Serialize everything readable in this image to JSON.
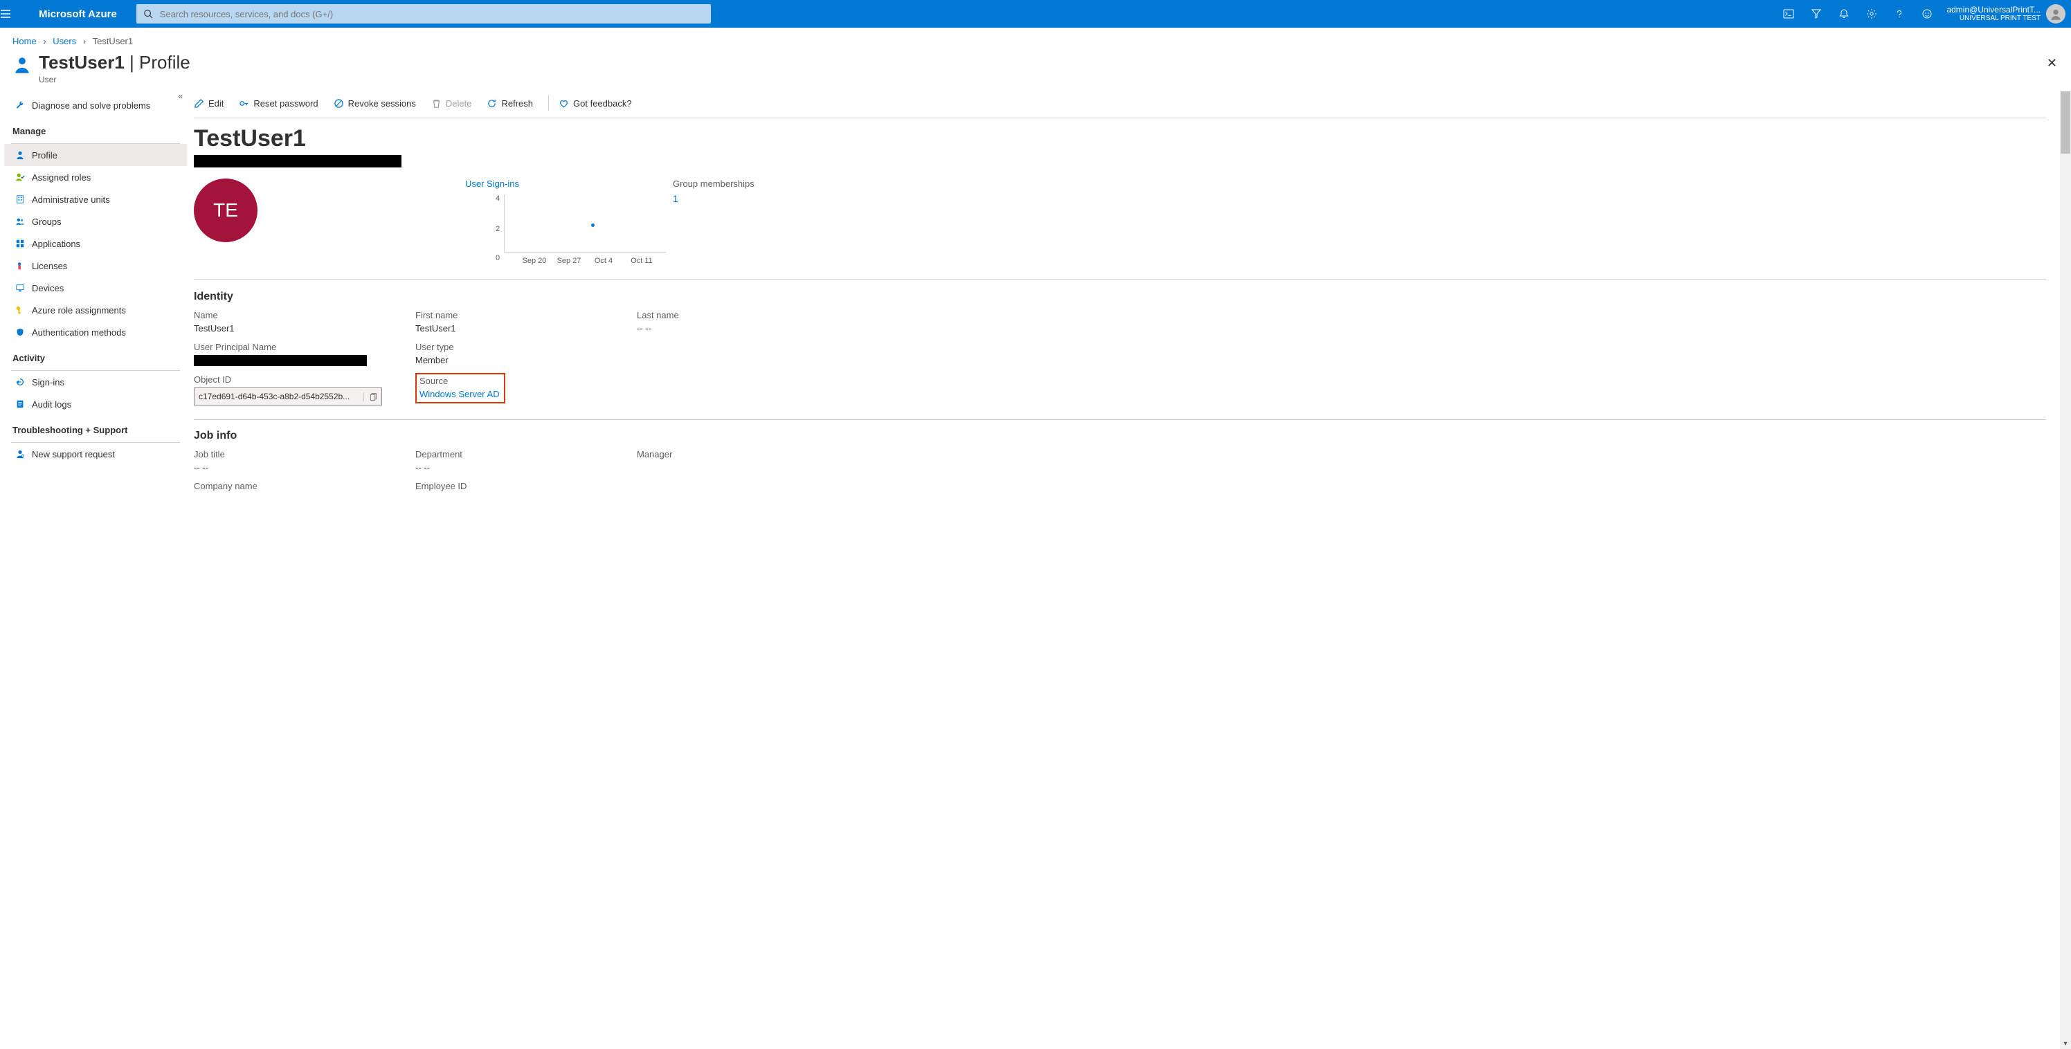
{
  "brand": "Microsoft Azure",
  "search": {
    "placeholder": "Search resources, services, and docs (G+/)"
  },
  "account": {
    "email": "admin@UniversalPrintT...",
    "tenant": "UNIVERSAL PRINT TEST"
  },
  "breadcrumb": {
    "home": "Home",
    "users": "Users",
    "current": "TestUser1"
  },
  "page": {
    "title": "TestUser1",
    "suffix": " | Profile",
    "subtitle": "User"
  },
  "toolbar": {
    "edit": "Edit",
    "reset_password": "Reset password",
    "revoke_sessions": "Revoke sessions",
    "delete": "Delete",
    "refresh": "Refresh",
    "got_feedback": "Got feedback?"
  },
  "sidebar": {
    "diagnose": "Diagnose and solve problems",
    "manage_label": "Manage",
    "manage": [
      {
        "label": "Profile"
      },
      {
        "label": "Assigned roles"
      },
      {
        "label": "Administrative units"
      },
      {
        "label": "Groups"
      },
      {
        "label": "Applications"
      },
      {
        "label": "Licenses"
      },
      {
        "label": "Devices"
      },
      {
        "label": "Azure role assignments"
      },
      {
        "label": "Authentication methods"
      }
    ],
    "activity_label": "Activity",
    "activity": [
      {
        "label": "Sign-ins"
      },
      {
        "label": "Audit logs"
      }
    ],
    "troubleshoot_label": "Troubleshooting + Support",
    "troubleshoot": [
      {
        "label": "New support request"
      }
    ]
  },
  "profile": {
    "big_name": "TestUser1",
    "avatar_initials": "TE",
    "signin_label": "User Sign-ins",
    "group_label": "Group memberships",
    "group_count": "1"
  },
  "chart_data": {
    "type": "scatter",
    "title": "User Sign-ins",
    "xlabel": "",
    "ylabel": "",
    "ylim": [
      0,
      4
    ],
    "y_ticks": [
      0,
      2,
      4
    ],
    "categories": [
      "Sep 20",
      "Sep 27",
      "Oct 4",
      "Oct 11"
    ],
    "series": [
      {
        "name": "Sign-ins",
        "values": [
          null,
          null,
          2,
          null
        ]
      }
    ]
  },
  "identity": {
    "section_label": "Identity",
    "name_label": "Name",
    "name_value": "TestUser1",
    "first_name_label": "First name",
    "first_name_value": "TestUser1",
    "last_name_label": "Last name",
    "last_name_value": "-- --",
    "upn_label": "User Principal Name",
    "user_type_label": "User type",
    "user_type_value": "Member",
    "object_id_label": "Object ID",
    "object_id_value": "c17ed691-d64b-453c-a8b2-d54b2552b...",
    "source_label": "Source",
    "source_value": "Windows Server AD"
  },
  "job": {
    "section_label": "Job info",
    "job_title_label": "Job title",
    "job_title_value": "-- --",
    "department_label": "Department",
    "department_value": "-- --",
    "manager_label": "Manager",
    "company_label": "Company name",
    "employee_id_label": "Employee ID"
  }
}
